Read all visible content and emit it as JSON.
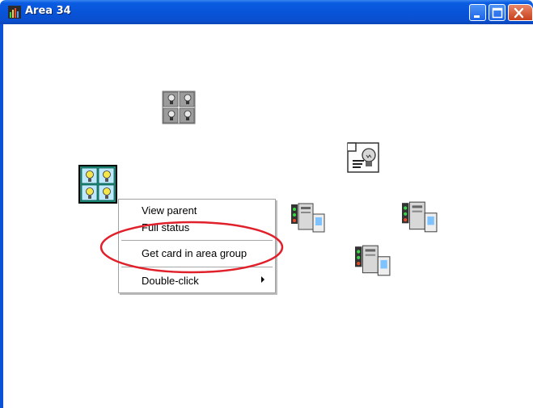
{
  "window": {
    "title": "Area 34",
    "app_icon": "graph-icon",
    "controls": [
      "minimize-icon",
      "maximize-icon",
      "close-icon"
    ],
    "accent_color": "#0a5ce2"
  },
  "canvas_icons": [
    {
      "name": "area-group-icon"
    },
    {
      "name": "lighting-output-icon"
    },
    {
      "name": "selected-area-group-icon"
    },
    {
      "name": "controller-card-icon"
    },
    {
      "name": "controller-card-icon"
    },
    {
      "name": "controller-card-icon"
    }
  ],
  "context_menu": {
    "items": [
      {
        "label": "View parent"
      },
      {
        "label": "Full status"
      },
      {
        "label": "Get card in area group"
      },
      {
        "label": "Double-click",
        "has_submenu": true
      }
    ],
    "highlight_color": "#e0202a"
  }
}
